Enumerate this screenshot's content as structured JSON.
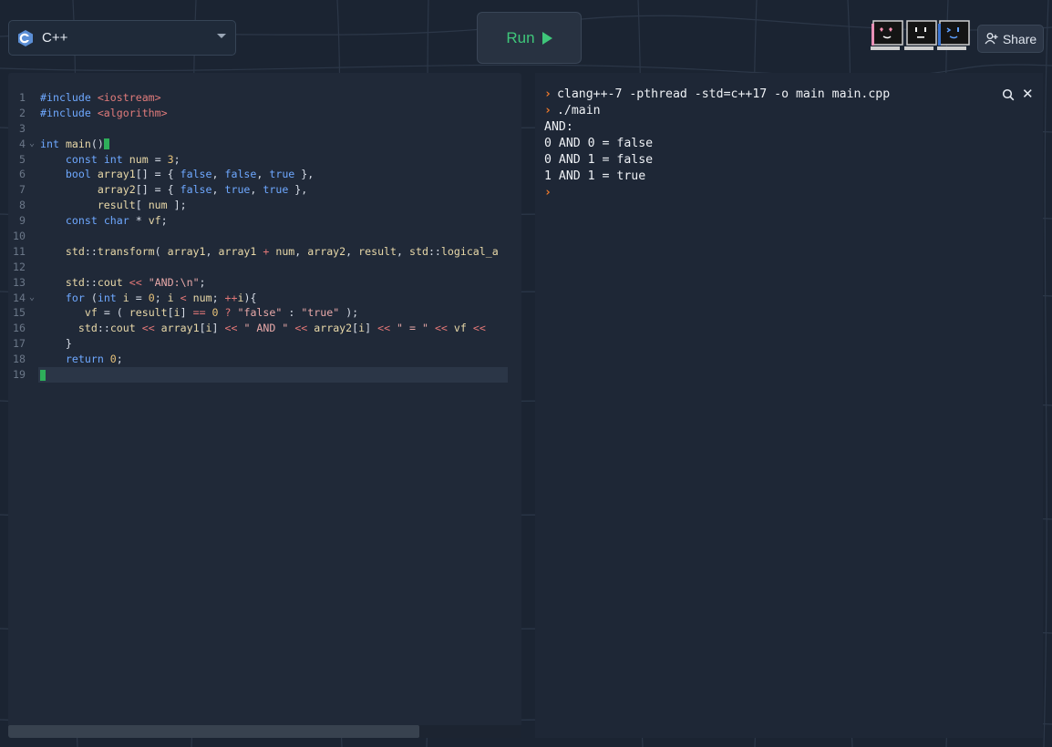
{
  "language_selector": {
    "label": "C++",
    "icon": "cpp-logo"
  },
  "run_button": {
    "label": "Run",
    "icon": "play-icon"
  },
  "avatars": [
    "heart-eyes-computer-avatar",
    "neutral-face-computer-avatar",
    "wink-face-computer-avatar"
  ],
  "share_button": {
    "label": "Share",
    "icon": "add-user-icon"
  },
  "editor": {
    "lines": [
      {
        "num": "1",
        "text": "#include <iostream>"
      },
      {
        "num": "2",
        "text": "#include <algorithm>"
      },
      {
        "num": "3",
        "text": ""
      },
      {
        "num": "4",
        "text": "int main()"
      },
      {
        "num": "5",
        "text": "    const int num = 3;"
      },
      {
        "num": "6",
        "text": "    bool array1[] = { false, false, true },"
      },
      {
        "num": "7",
        "text": "         array2[] = { false, true, true },"
      },
      {
        "num": "8",
        "text": "         result[ num ];"
      },
      {
        "num": "9",
        "text": "    const char * vf;"
      },
      {
        "num": "10",
        "text": ""
      },
      {
        "num": "11",
        "text": "    std::transform( array1, array1 + num, array2, result, std::logical_a"
      },
      {
        "num": "12",
        "text": ""
      },
      {
        "num": "13",
        "text": "    std::cout << \"AND:\\n\";"
      },
      {
        "num": "14",
        "text": "    for (int i = 0; i < num; ++i){"
      },
      {
        "num": "15",
        "text": "       vf = ( result[i] == 0 ? \"false\" : \"true\" );"
      },
      {
        "num": "16",
        "text": "      std::cout << array1[i] << \" AND \" << array2[i] << \" = \" << vf <<"
      },
      {
        "num": "17",
        "text": "    }"
      },
      {
        "num": "18",
        "text": "    return 0;"
      },
      {
        "num": "19",
        "text": ""
      }
    ]
  },
  "terminal": {
    "lines": [
      {
        "prompt": true,
        "text": "clang++-7 -pthread -std=c++17 -o main main.cpp"
      },
      {
        "prompt": true,
        "text": "./main"
      },
      {
        "prompt": false,
        "text": "AND:"
      },
      {
        "prompt": false,
        "text": "0 AND 0 = false"
      },
      {
        "prompt": false,
        "text": "0 AND 1 = false"
      },
      {
        "prompt": false,
        "text": "1 AND 1 = true"
      },
      {
        "prompt": true,
        "text": ""
      }
    ],
    "prompt_symbol": "›"
  },
  "colors": {
    "accent_green": "#3fc67a",
    "prompt_orange": "#f07a2b",
    "background": "#1b2432"
  }
}
